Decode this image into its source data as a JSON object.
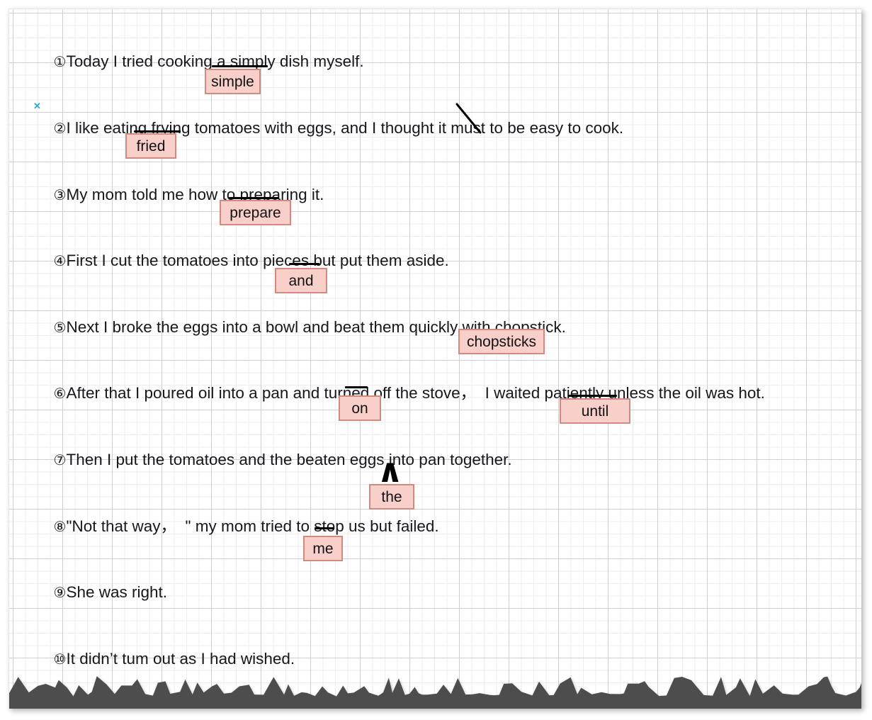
{
  "document": {
    "kind": "scanned-essay-correction-sheet",
    "paper": {
      "background_color": "#ffffff",
      "grid_minor_color": "#eeeeee",
      "grid_major_color": "#cfcfcf",
      "torn_edge_color": "#5a5a5a"
    },
    "correction_style": {
      "chip_fill": "#f9cfc9",
      "chip_border": "#d08b81",
      "underline_color": "#000000",
      "mark_color": "#2aa8e0"
    }
  },
  "annotations": {
    "blue_x": {
      "glyph": "✕",
      "name": "blue-x-mark"
    },
    "caret": {
      "glyph": "∧",
      "name": "insertion-caret"
    }
  },
  "lines": [
    {
      "marker": "①",
      "text": "Today I tried cooking a simply dish myself.",
      "error_word": "simply",
      "correction": "simple"
    },
    {
      "marker": "②",
      "text": "I like eating frying tomatoes with eggs, and I thought it must to be easy to cook.",
      "error_word": "frying",
      "correction": "fried",
      "deleted_word": "to"
    },
    {
      "marker": "③",
      "text": "My mom told me how to preparing it.",
      "error_word": "preparing",
      "correction": "prepare"
    },
    {
      "marker": "④",
      "text": "First I cut the tomatoes into pieces but put them aside.",
      "error_word": "but",
      "correction": "and"
    },
    {
      "marker": "⑤",
      "text": "Next I broke the eggs into a bowl and beat them quickly with chopstick.",
      "error_word": "chopstick.",
      "correction": "chopsticks"
    },
    {
      "marker": "⑥",
      "text": "After that I poured oil into a pan and turned off the stove，  I waited patiently unless the oil was hot.",
      "error_word": "off",
      "correction": "on",
      "error_word_2": "unless",
      "correction_2": "until"
    },
    {
      "marker": "⑦",
      "text": "Then I put the tomatoes and the beaten eggs into pan together.",
      "insertion": "the"
    },
    {
      "marker": "⑧",
      "text": "\"Not that way，  \" my mom tried to stop us but failed.",
      "error_word": "us",
      "correction": "me"
    },
    {
      "marker": "⑨",
      "text": "She was right."
    },
    {
      "marker": "⑩",
      "text": "It didn’t tum out as I had wished."
    }
  ]
}
